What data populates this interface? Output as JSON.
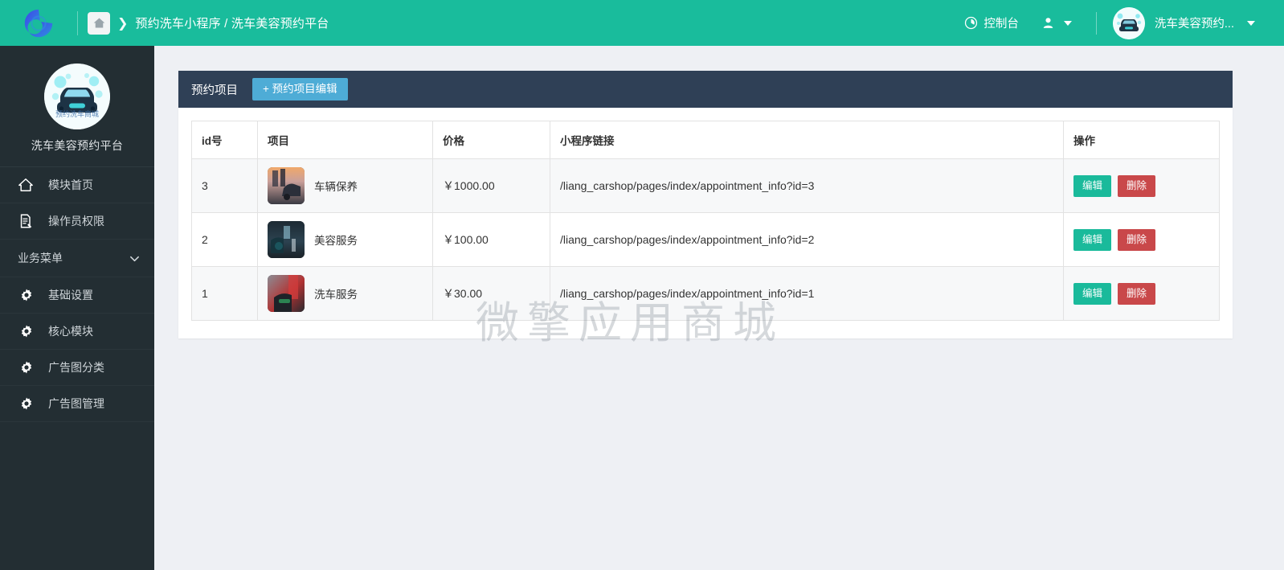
{
  "header": {
    "logo_icon": "swirl-logo-icon",
    "home_icon": "home-icon",
    "breadcrumb_separator": "❯",
    "breadcrumb_text": "预约洗车小程序 / 洗车美容预约平台",
    "console": {
      "label": "控制台",
      "icon": "target-console-icon"
    },
    "user": {
      "icon": "user-icon",
      "caret": "chevron-down-icon"
    },
    "account": {
      "name": "洗车美容预约...",
      "avatar_icon": "carwash-avatar-icon",
      "caret": "chevron-down-icon"
    }
  },
  "sidebar": {
    "brand_title": "洗车美容预约平台",
    "brand_avatar_icon": "carwash-avatar-icon",
    "brand_avatar_caption": "预约洗车商城",
    "items": [
      {
        "label": "模块首页",
        "icon": "home-outline-icon",
        "type": "item"
      },
      {
        "label": "操作员权限",
        "icon": "document-pencil-icon",
        "type": "item"
      },
      {
        "label": "业务菜单",
        "icon": "chevron-down-icon",
        "type": "group"
      },
      {
        "label": "基础设置",
        "icon": "gear-icon",
        "type": "sub"
      },
      {
        "label": "核心模块",
        "icon": "gear-icon",
        "type": "sub"
      },
      {
        "label": "广告图分类",
        "icon": "gear-icon",
        "type": "sub"
      },
      {
        "label": "广告图管理",
        "icon": "gear-icon",
        "type": "sub"
      }
    ]
  },
  "main": {
    "tab_label": "预约项目",
    "add_button_label": "+ 预约项目编辑",
    "watermark": "微擎应用商城",
    "table": {
      "columns": [
        "id号",
        "项目",
        "价格",
        "小程序链接",
        "操作"
      ],
      "rows": [
        {
          "id": "3",
          "item": "车辆保养",
          "thumb": "maintenance-thumb",
          "price": "￥1000.00",
          "link": "/liang_carshop/pages/index/appointment_info?id=3",
          "edit_label": "编辑",
          "delete_label": "删除"
        },
        {
          "id": "2",
          "item": "美容服务",
          "thumb": "beauty-thumb",
          "price": "￥100.00",
          "link": "/liang_carshop/pages/index/appointment_info?id=2",
          "edit_label": "编辑",
          "delete_label": "删除"
        },
        {
          "id": "1",
          "item": "洗车服务",
          "thumb": "carwash-thumb",
          "price": "￥30.00",
          "link": "/liang_carshop/pages/index/appointment_info?id=1",
          "edit_label": "编辑",
          "delete_label": "删除"
        }
      ]
    }
  },
  "colors": {
    "header_teal": "#19bc9c",
    "sidebar_dark": "#232e33",
    "tabbar_navy": "#2f4056",
    "page_bg": "#eef0f4",
    "add_button_blue": "#4eacd6",
    "edit_green": "#1aba9b",
    "delete_red": "#c9484a"
  }
}
